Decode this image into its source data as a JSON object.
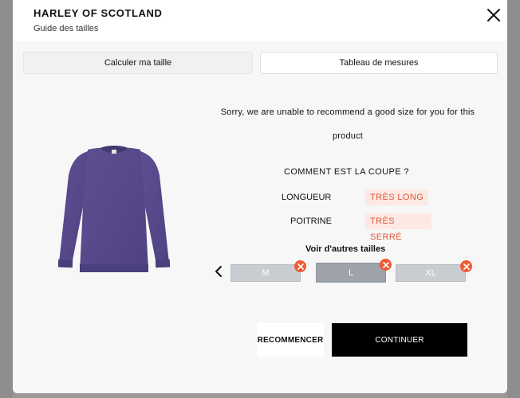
{
  "header": {
    "brand": "HARLEY OF SCOTLAND",
    "subtitle": "Guide des tailles"
  },
  "tabs": [
    {
      "label": "Calculer ma taille",
      "active": true
    },
    {
      "label": "Tableau de mesures",
      "active": false
    }
  ],
  "product": {
    "image_description": "purple crew-neck sweater",
    "color": "#5a4a8a"
  },
  "recommendation": {
    "message": "Sorry, we are unable to recommend a good size for you for this product"
  },
  "fit": {
    "title": "COMMENT EST LA COUPE ?",
    "rows": [
      {
        "label": "LONGUEUR",
        "value": "TRÈS LONG"
      },
      {
        "label": "POITRINE",
        "value": "TRÈS SERRÉ"
      }
    ]
  },
  "other_sizes": {
    "title": "Voir d'autres tailles",
    "sizes": [
      {
        "label": "M",
        "selected": false
      },
      {
        "label": "L",
        "selected": true
      },
      {
        "label": "XL",
        "selected": false
      }
    ]
  },
  "actions": {
    "restart": "RECOMMENCER",
    "continue": "CONTINUER"
  },
  "colors": {
    "accent_warning": "#ee5a36",
    "badge_bg": "#fce9e4",
    "primary_button": "#000000"
  }
}
